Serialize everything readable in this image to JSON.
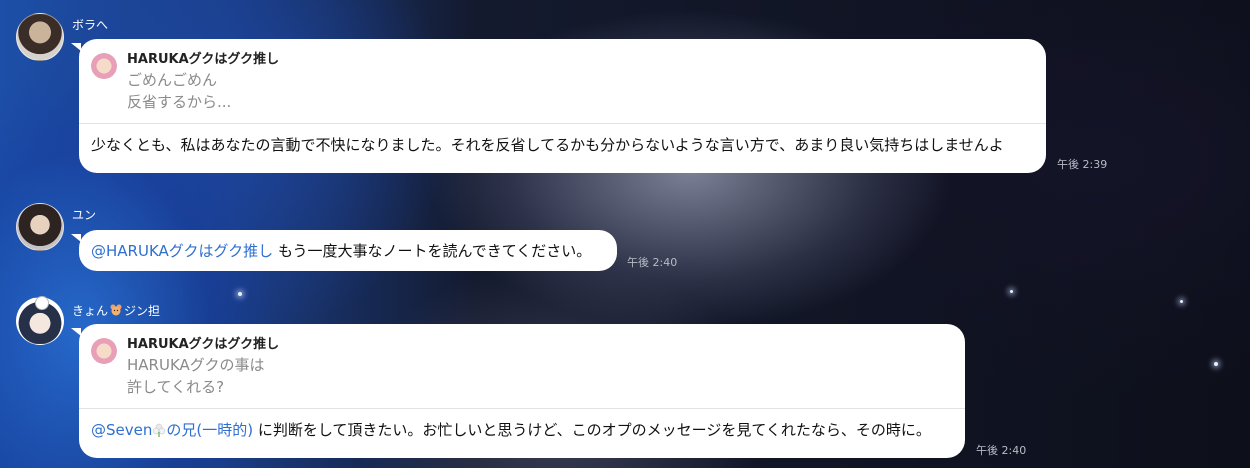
{
  "messages": [
    {
      "sender": "ボラへ",
      "reply": {
        "name": "HARUKAグクはグク推し",
        "lines": [
          "ごめんごめん",
          "反省するから..."
        ]
      },
      "text": "少なくとも、私はあなたの言動で不快になりました。それを反省してるかも分からないような言い方で、あまり良い気持ちはしませんよ",
      "time": "午後 2:39"
    },
    {
      "sender": "ユン",
      "mention": "@HARUKAグクはグク推し",
      "text": " もう一度大事なノートを読んできてください。",
      "time": "午後 2:40"
    },
    {
      "sender_prefix": "きょん",
      "sender_suffix": "ジン担",
      "reply": {
        "name": "HARUKAグクはグク推し",
        "lines": [
          "HARUKAグクの事は",
          "許してくれる?"
        ]
      },
      "mention_a": "@Seven",
      "mention_b": "の兄(一時的)",
      "text": " に判断をして頂きたい。お忙しいと思うけど、このオプのメッセージを見てくれたなら、その時に。",
      "time": "午後 2:40"
    }
  ]
}
